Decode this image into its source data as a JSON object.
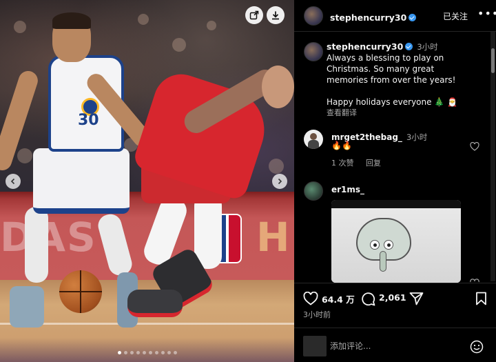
{
  "post": {
    "username": "stephencurry30",
    "follow_status": "已关注",
    "caption_time": "3小时",
    "caption_line1": "Always a blessing to play on",
    "caption_line2": "Christmas. So many great",
    "caption_line3": "memories from over the years!",
    "caption_line4": "Happy holidays everyone",
    "caption_emojis": "🎄 🎅",
    "see_translation": "查看翻译"
  },
  "media": {
    "jersey_number": "30",
    "ad_left_text": "DAS",
    "ad_right_text": "H",
    "carousel_total": 10,
    "carousel_active": 0
  },
  "comments": [
    {
      "username": "mrget2thebag_",
      "time": "3小时",
      "text": "🔥🔥",
      "likes": "1 次赞",
      "reply": "回复"
    },
    {
      "username": "er1ms_"
    }
  ],
  "actions": {
    "likes": "64.4 万",
    "comments": "2,061",
    "posted": "3小时前"
  },
  "input": {
    "placeholder": "添加评论..."
  },
  "colors": {
    "verified": "#3897f0",
    "bg": "#000000",
    "muted": "#a8a8a8"
  }
}
